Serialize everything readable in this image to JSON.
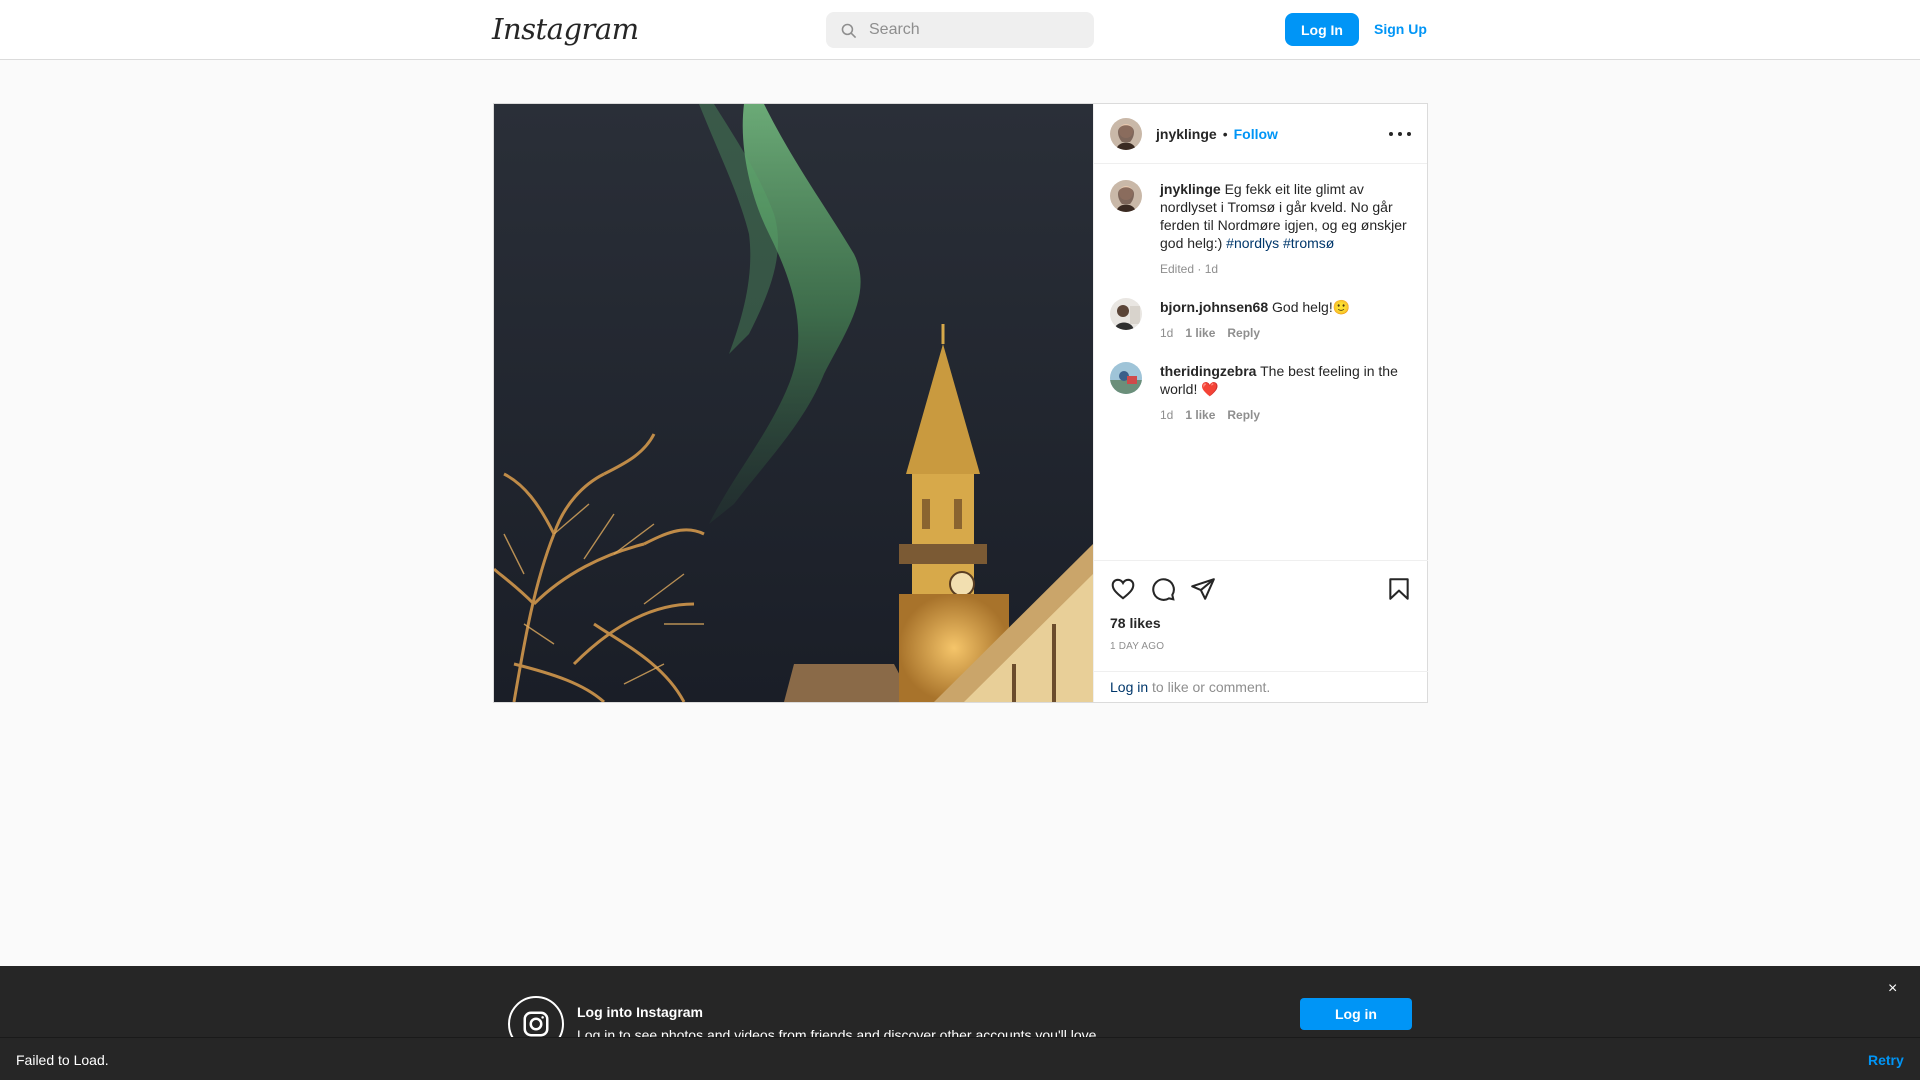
{
  "header": {
    "logo": "Instagram",
    "search_placeholder": "Search",
    "login_label": "Log In",
    "signup_label": "Sign Up"
  },
  "post": {
    "author": "jnyklinge",
    "separator": "•",
    "follow_label": "Follow",
    "caption": {
      "author": "jnyklinge",
      "text": " Eg fekk eit lite glimt av nordlyset i Tromsø i går kveld. No går ferden til Nordmøre igjen, og eg ønskjer god helg:) ",
      "hashtags": [
        "#nordlys",
        "#tromsø"
      ],
      "meta": "Edited · 1d"
    },
    "comments": [
      {
        "author": "bjorn.johnsen68",
        "text": " God helg!🙂",
        "time": "1d",
        "likes": "1 like",
        "reply": "Reply"
      },
      {
        "author": "theridingzebra",
        "text": " The best feeling in the world! ❤️",
        "time": "1d",
        "likes": "1 like",
        "reply": "Reply"
      }
    ],
    "likes": "78 likes",
    "date": "1 DAY AGO",
    "login_link": "Log in",
    "login_suffix": " to like or comment."
  },
  "banner": {
    "title": "Log into Instagram",
    "subtitle": "Log in to see photos and videos from friends and discover other accounts you'll love.",
    "button": "Log in",
    "close": "×"
  },
  "failbar": {
    "message": "Failed to Load.",
    "retry": "Retry"
  },
  "colors": {
    "accent": "#0095f6",
    "hashtag": "#00376b",
    "aurora": "#6fbf73",
    "sky": "#1f2430"
  }
}
